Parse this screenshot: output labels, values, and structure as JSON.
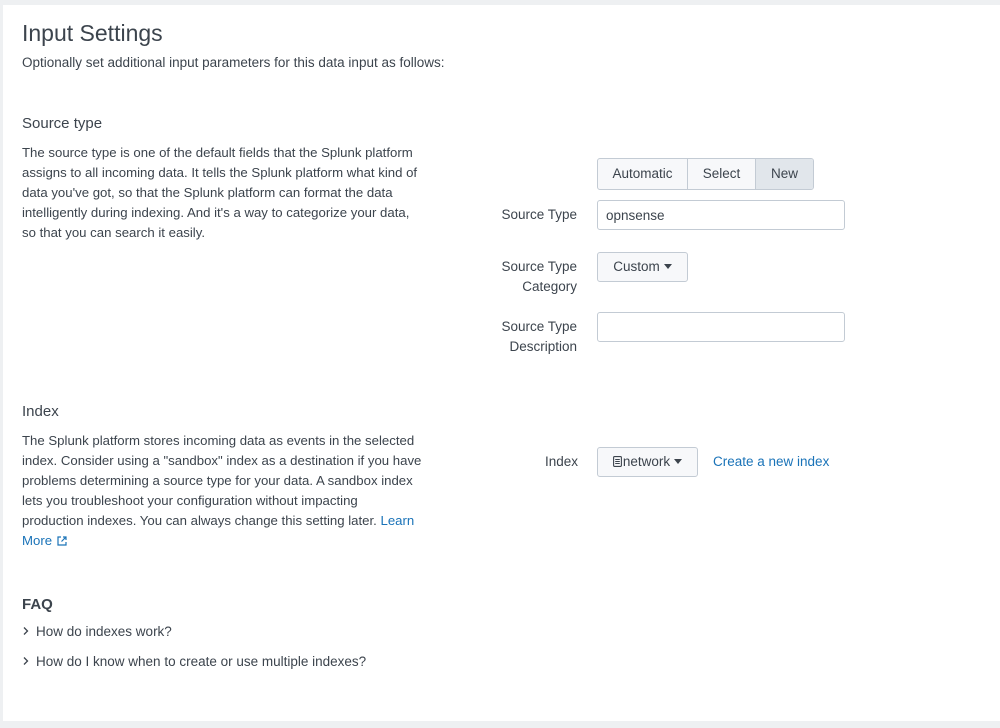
{
  "page": {
    "title": "Input Settings",
    "subtitle": "Optionally set additional input parameters for this data input as follows:"
  },
  "source_type_section": {
    "title": "Source type",
    "description": "The source type is one of the default fields that the Splunk platform assigns to all incoming data. It tells the Splunk platform what kind of data you've got, so that the Splunk platform can format the data intelligently during indexing. And it's a way to categorize your data, so that you can search it easily.",
    "mode_buttons": {
      "automatic": "Automatic",
      "select": "Select",
      "new": "New",
      "active": "New"
    },
    "source_type_label": "Source Type",
    "source_type_value": "opnsense",
    "category_label_line1": "Source Type",
    "category_label_line2": "Category",
    "category_value": "Custom",
    "description_label_line1": "Source Type",
    "description_label_line2": "Description",
    "description_value": ""
  },
  "index_section": {
    "title": "Index",
    "description": "The Splunk platform stores incoming data as events in the selected index. Consider using a \"sandbox\" index as a destination if you have problems determining a source type for your data. A sandbox index lets you troubleshoot your configuration without impacting production indexes. You can always change this setting later. ",
    "learn_more": "Learn More",
    "index_label": "Index",
    "index_value": "network",
    "create_link": "Create a new index"
  },
  "faq": {
    "title": "FAQ",
    "items": [
      "How do indexes work?",
      "How do I know when to create or use multiple indexes?"
    ]
  },
  "icons": {
    "external_link": "external-link-icon",
    "database": "database-icon",
    "chevron": "chevron-right-icon",
    "caret": "caret-down-icon"
  },
  "colors": {
    "link": "#1a73b8",
    "text": "#3c444d",
    "active_segment": "#e1e6eb"
  }
}
